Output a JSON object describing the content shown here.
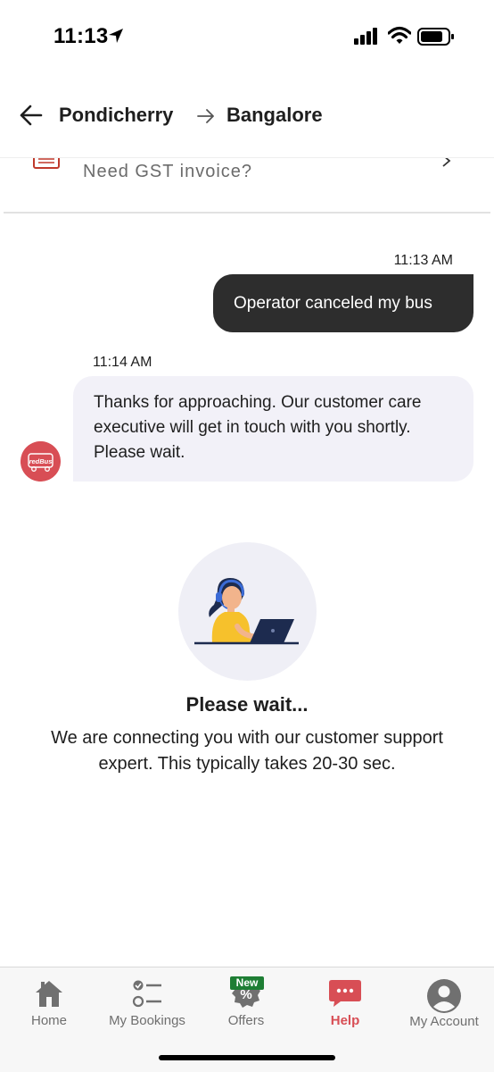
{
  "status_bar": {
    "time": "11:13"
  },
  "header": {
    "from": "Pondicherry",
    "to": "Bangalore"
  },
  "gst": {
    "label": "Need GST invoice?"
  },
  "chat": {
    "user_message": {
      "time": "11:13 AM",
      "text": "Operator canceled my bus"
    },
    "agent_message": {
      "time": "11:14 AM",
      "text": "Thanks for approaching. Our customer care executive will get in touch with you shortly. Please wait.",
      "avatar_text": "redBus"
    }
  },
  "waiting": {
    "title": "Please wait...",
    "description": "We are connecting you with our customer support expert. This typically takes 20-30 sec."
  },
  "bottom_nav": {
    "active": "Help",
    "badge": "New",
    "items": [
      {
        "label": "Home",
        "icon": "home-icon"
      },
      {
        "label": "My Bookings",
        "icon": "bookings-list-icon"
      },
      {
        "label": "Offers",
        "icon": "offers-percent-icon"
      },
      {
        "label": "Help",
        "icon": "help-chat-icon"
      },
      {
        "label": "My Account",
        "icon": "account-icon"
      }
    ]
  },
  "colors": {
    "brand_red": "#d84e55",
    "user_bubble": "#2d2d2d",
    "agent_bubble": "#f2f1f8",
    "badge_green": "#1e7e34"
  }
}
